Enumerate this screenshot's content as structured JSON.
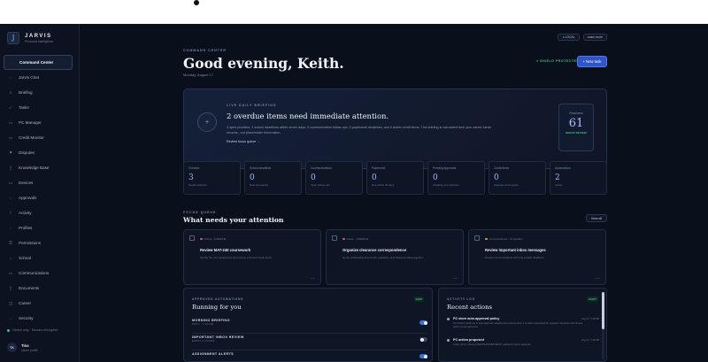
{
  "brand": {
    "logo": "J",
    "name": "JARVIS",
    "subtitle": "Personal intelligence"
  },
  "sidebar": {
    "items": [
      {
        "label": "Command Center",
        "icon": "",
        "active": true
      },
      {
        "label": "Jarvis Chat",
        "icon": "◌"
      },
      {
        "label": "Briefing",
        "icon": "≡"
      },
      {
        "label": "Tasks",
        "icon": "✓"
      },
      {
        "label": "PC Manager",
        "icon": "▭"
      },
      {
        "label": "Credit Monitor",
        "icon": "▭"
      },
      {
        "label": "Disputes",
        "icon": "⚑"
      },
      {
        "label": "Knowledge Base",
        "icon": "▯"
      },
      {
        "label": "Devices",
        "icon": "▭"
      },
      {
        "label": "Approvals",
        "icon": "◌"
      },
      {
        "label": "Activity",
        "icon": "⌇"
      },
      {
        "label": "Profiles",
        "icon": "◌"
      },
      {
        "label": "Permissions",
        "icon": "⚿"
      },
      {
        "label": "School",
        "icon": "⌂"
      },
      {
        "label": "Communications",
        "icon": "▭"
      },
      {
        "label": "Documents",
        "icon": "▯"
      },
      {
        "label": "Career",
        "icon": "◫"
      },
      {
        "label": "Security",
        "icon": "◌"
      }
    ],
    "status": "Device only · Session encrypted",
    "user": {
      "initials": "TK",
      "name": "Tina",
      "role": "owner profile"
    }
  },
  "header": {
    "chips": [
      {
        "label": "LOCAL",
        "dot": "●"
      },
      {
        "label": "Learn more",
        "dot": ""
      }
    ],
    "eyebrow": "COMMAND CENTER",
    "greeting": "Good evening, Keith.",
    "date": "Monday, August 17",
    "shield": "● SHIELD PROTECTED",
    "new_task": "+ New task"
  },
  "briefing": {
    "icon": "+",
    "eyebrow": "LIVE DAILY BRIEFING",
    "title": "2 overdue items need immediate attention.",
    "text": "3 open priorities, 2 school deadlines within seven days, 0 communication follow-ups, 0 paperwork deadlines, and 0 active credit items. This briefing is calculated from your saved Jarvis records—not placeholder information.",
    "link": "Review focus queue →",
    "score": {
      "label": "Readiness",
      "value": "61",
      "sub": "NEEDS REVIEW"
    }
  },
  "stats": [
    {
      "label": "Overdue",
      "value": "3",
      "sub": "Needs attention"
    },
    {
      "label": "School deadlines",
      "value": "0",
      "sub": "Next two weeks"
    },
    {
      "label": "Communications",
      "value": "0",
      "sub": "Open follow-ups"
    },
    {
      "label": "Paperwork",
      "value": "0",
      "sub": "Due within 30 days"
    },
    {
      "label": "Pending approvals",
      "value": "0",
      "sub": "Awaiting your decision"
    },
    {
      "label": "Credit items",
      "value": "0",
      "sub": "Disputes and reports"
    },
    {
      "label": "Automations",
      "value": "2",
      "sub": "Active"
    }
  ],
  "focus": {
    "eyebrow": "FOCUS QUEUE",
    "title": "What needs your attention",
    "view_all": "View all"
  },
  "tasks": [
    {
      "meta": "School · OVERDUE",
      "priority": "red",
      "title": "Review MAT-240 coursework",
      "desc": "Identify the next assignment and reserve a focused study block."
    },
    {
      "meta": "Career · OVERDUE",
      "priority": "red",
      "title": "Organize clearance correspondence",
      "desc": "Group outstanding documents, questions, and follow-up dates together."
    },
    {
      "meta": "Communications · No deadline",
      "priority": "amber",
      "title": "Review important inbox messages",
      "desc": "Review communications that may contain deadlines."
    }
  ],
  "automations": {
    "eyebrow": "APPROVED AUTOMATIONS",
    "title": "Running for you",
    "badge": "NOW",
    "items": [
      {
        "name": "MORNING BRIEFING",
        "sub": "DAILY · 7:30 AM",
        "on": true
      },
      {
        "name": "IMPORTANT INBOX REVIEW",
        "sub": "EVERY 2 HOURS",
        "on": false
      },
      {
        "name": "ASSIGNMENT ALERTS",
        "sub": "",
        "on": true
      }
    ]
  },
  "activity": {
    "eyebrow": "ACTIVITY LOG",
    "title": "Recent actions",
    "badge": "AUDIT",
    "items": [
      {
        "title": "PC store auto-approval policy",
        "time": "Aug 17, 7:48 PM",
        "desc": "Permission mode set to auto-approval: reliable automations when it remains supervised for repeated. Sensitive and remote paths remain approved."
      },
      {
        "title": "PC action proposed",
        "time": "Aug 17, 7:48 PM",
        "desc": "mode_list for Jarvis-profile/PhotoUSB/USBUP, waiting for owner approval."
      }
    ]
  },
  "colors": {
    "accent": "#2f55c9",
    "good": "#3fbf7f",
    "danger": "#e25a68",
    "background": "#0a0f1c"
  }
}
